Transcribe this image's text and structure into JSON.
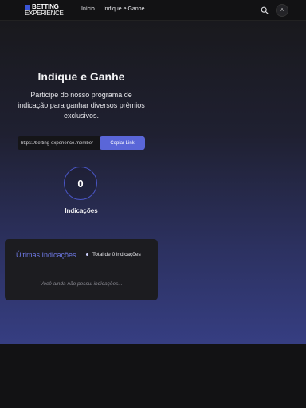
{
  "header": {
    "logo_top": "BETTING",
    "logo_bottom": "EXPERIENCE",
    "nav": [
      "Início",
      "Indique e Ganhe"
    ],
    "avatar_initial": "A",
    "icons": {
      "search": "search-icon"
    }
  },
  "main": {
    "title": "Indique e Ganhe",
    "subtitle": "Participe do nosso programa de indicação para ganhar diversos prêmios exclusivos.",
    "referral_link": "https://betting-experience.member",
    "copy_button": "Copiar Link",
    "count": "0",
    "count_label": "Indicações"
  },
  "panel": {
    "title": "Últimas Indicações",
    "total": "Total de 0 indicações",
    "empty_message": "Você ainda não possui indicações..."
  },
  "colors": {
    "accent": "#5a66d8",
    "panel_title": "#6f7ae8",
    "background": "#1a1a1d"
  }
}
